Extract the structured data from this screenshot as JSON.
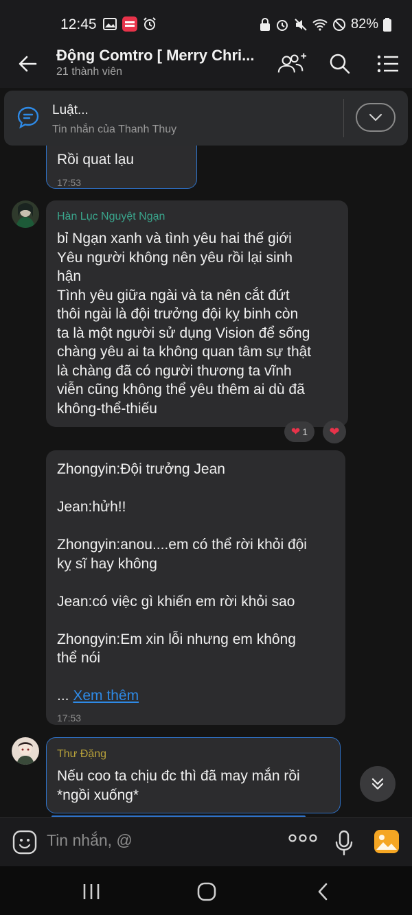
{
  "status_bar": {
    "time": "12:45",
    "battery": "82%",
    "icons_left": [
      "image-icon",
      "manga-toon-icon",
      "alarm-icon"
    ],
    "icons_right": [
      "lock-icon",
      "alarm-icon",
      "mute-icon",
      "wifi-icon",
      "no-disturb-icon",
      "battery-icon"
    ]
  },
  "header": {
    "title": "Động Comtro [ Merry Chri...",
    "subtitle": "21 thành viên"
  },
  "pinned": {
    "title": "Luật...",
    "subtitle": "Tin nhắn của Thanh Thuy"
  },
  "messages": [
    {
      "text": "Rồi quat lạu",
      "time": "17:53"
    },
    {
      "sender": "Hàn Lục Nguyệt Ngạn",
      "sender_color": "#3aa58c",
      "lines": [
        "bỉ Ngạn xanh và tình yêu hai thế giới",
        "Yêu người không nên yêu rồi lại sinh",
        "hận",
        "Tình yêu giữa ngài và ta nên cắt đứt",
        "thôi ngài là đội trưởng đội kỵ binh còn",
        "ta là một người sử dụng Vision để sống",
        "chàng yêu ai ta không quan tâm sự thật",
        "là chàng đã có người thương ta vĩnh",
        "viễn cũng không thể yêu thêm ai dù đã",
        "không-thể-thiếu"
      ],
      "reaction_count": "1"
    },
    {
      "lines": [
        "Zhongyin:Đội trưởng Jean",
        "",
        "Jean:hửh!!",
        "",
        "Zhongyin:anou....em có thể rời khỏi đội",
        "kỵ sĩ hay không",
        "",
        "Jean:có việc gì khiến em rời khỏi sao",
        "",
        "Zhongyin:Em xin lỗi nhưng em không",
        "thể nói",
        ""
      ],
      "ellipsis": "...",
      "see_more": "Xem thêm",
      "time": "17:53"
    },
    {
      "sender": "Thư Đặng",
      "sender_color": "#b8a23a",
      "lines": [
        "Nếu coo ta chịu đc thì đã may mắn rồi",
        "*ngồi xuống*"
      ]
    }
  ],
  "input": {
    "placeholder": "Tin nhắn, @"
  },
  "colors": {
    "accent": "#2e8ae6",
    "bubble": "#2c2c2e",
    "background": "#141414"
  }
}
